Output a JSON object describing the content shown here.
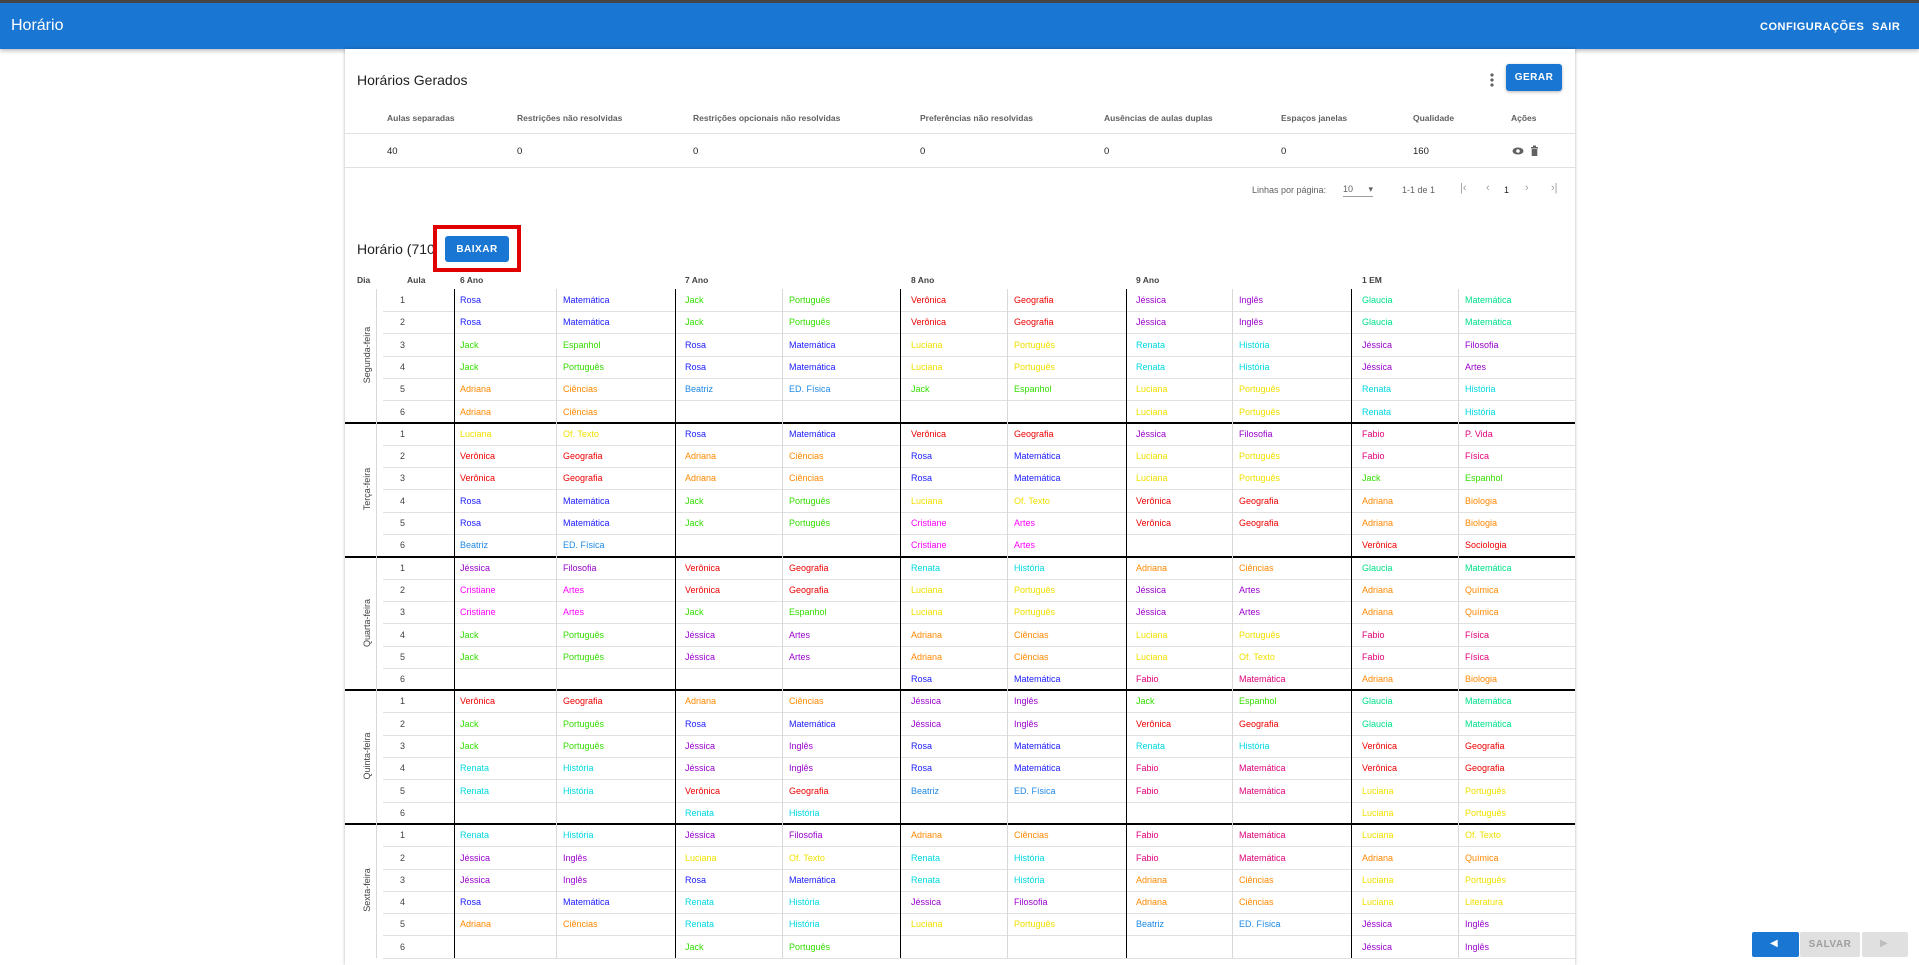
{
  "app": {
    "title": "Horário",
    "settings_label": "CONFIGURAÇÕES",
    "logout_label": "SAIR"
  },
  "generated": {
    "title": "Horários Gerados",
    "generate_label": "GERAR",
    "columns": [
      "Aulas separadas",
      "Restrições não resolvidas",
      "Restrições opcionais não resolvidas",
      "Preferências não resolvidas",
      "Ausências de aulas duplas",
      "Espaços janelas",
      "Qualidade",
      "Ações"
    ],
    "row": [
      "40",
      "0",
      "0",
      "0",
      "0",
      "0",
      "160"
    ],
    "pagination": {
      "rows_per_page_label": "Linhas por página:",
      "rows_per_page": "10",
      "range": "1-1 de 1",
      "page": "1"
    }
  },
  "schedule": {
    "title": "Horário (710",
    "download_label": "BAIXAR",
    "day_header": "Dia",
    "lesson_header": "Aula",
    "classes": [
      "6 Ano",
      "7 Ano",
      "8 Ano",
      "9 Ano",
      "1 EM"
    ],
    "days": [
      {
        "name": "Segunda-feira",
        "rows": [
          [
            "1",
            "Rosa",
            "Matemática",
            "Jack",
            "Português",
            "Verônica",
            "Geografia",
            "Jéssica",
            "Inglês",
            "Glaucia",
            "Matemática"
          ],
          [
            "2",
            "Rosa",
            "Matemática",
            "Jack",
            "Português",
            "Verônica",
            "Geografia",
            "Jéssica",
            "Inglês",
            "Glaucia",
            "Matemática"
          ],
          [
            "3",
            "Jack",
            "Espanhol",
            "Rosa",
            "Matemática",
            "Luciana",
            "Português",
            "Renata",
            "História",
            "Jéssica",
            "Filosofia"
          ],
          [
            "4",
            "Jack",
            "Português",
            "Rosa",
            "Matemática",
            "Luciana",
            "Português",
            "Renata",
            "História",
            "Jéssica",
            "Artes"
          ],
          [
            "5",
            "Adriana",
            "Ciências",
            "Beatriz",
            "ED. Física",
            "Jack",
            "Espanhol",
            "Luciana",
            "Português",
            "Renata",
            "História"
          ],
          [
            "6",
            "Adriana",
            "Ciências",
            "",
            "",
            "",
            "",
            "Luciana",
            "Português",
            "Renata",
            "História"
          ]
        ]
      },
      {
        "name": "Terça-feira",
        "rows": [
          [
            "1",
            "Luciana",
            "Of. Texto",
            "Rosa",
            "Matemática",
            "Verônica",
            "Geografia",
            "Jéssica",
            "Filosofia",
            "Fabio",
            "P. Vida"
          ],
          [
            "2",
            "Verônica",
            "Geografia",
            "Adriana",
            "Ciências",
            "Rosa",
            "Matemática",
            "Luciana",
            "Português",
            "Fabio",
            "Física"
          ],
          [
            "3",
            "Verônica",
            "Geografia",
            "Adriana",
            "Ciências",
            "Rosa",
            "Matemática",
            "Luciana",
            "Português",
            "Jack",
            "Espanhol"
          ],
          [
            "4",
            "Rosa",
            "Matemática",
            "Jack",
            "Português",
            "Luciana",
            "Of. Texto",
            "Verônica",
            "Geografia",
            "Adriana",
            "Biologia"
          ],
          [
            "5",
            "Rosa",
            "Matemática",
            "Jack",
            "Português",
            "Cristiane",
            "Artes",
            "Verônica",
            "Geografia",
            "Adriana",
            "Biologia"
          ],
          [
            "6",
            "Beatriz",
            "ED. Física",
            "",
            "",
            "Cristiane",
            "Artes",
            "",
            "",
            "Verônica",
            "Sociologia"
          ]
        ]
      },
      {
        "name": "Quarta-feira",
        "rows": [
          [
            "1",
            "Jéssica",
            "Filosofia",
            "Verônica",
            "Geografia",
            "Renata",
            "História",
            "Adriana",
            "Ciências",
            "Glaucia",
            "Matemática"
          ],
          [
            "2",
            "Cristiane",
            "Artes",
            "Verônica",
            "Geografia",
            "Luciana",
            "Português",
            "Jéssica",
            "Artes",
            "Adriana",
            "Química"
          ],
          [
            "3",
            "Cristiane",
            "Artes",
            "Jack",
            "Espanhol",
            "Luciana",
            "Português",
            "Jéssica",
            "Artes",
            "Adriana",
            "Química"
          ],
          [
            "4",
            "Jack",
            "Português",
            "Jéssica",
            "Artes",
            "Adriana",
            "Ciências",
            "Luciana",
            "Português",
            "Fabio",
            "Física"
          ],
          [
            "5",
            "Jack",
            "Português",
            "Jéssica",
            "Artes",
            "Adriana",
            "Ciências",
            "Luciana",
            "Of. Texto",
            "Fabio",
            "Física"
          ],
          [
            "6",
            "",
            "",
            "",
            "",
            "Rosa",
            "Matemática",
            "Fabio",
            "Matemática",
            "Adriana",
            "Biologia"
          ]
        ]
      },
      {
        "name": "Quinta-feira",
        "rows": [
          [
            "1",
            "Verônica",
            "Geografia",
            "Adriana",
            "Ciências",
            "Jéssica",
            "Inglês",
            "Jack",
            "Espanhol",
            "Glaucia",
            "Matemática"
          ],
          [
            "2",
            "Jack",
            "Português",
            "Rosa",
            "Matemática",
            "Jéssica",
            "Inglês",
            "Verônica",
            "Geografia",
            "Glaucia",
            "Matemática"
          ],
          [
            "3",
            "Jack",
            "Português",
            "Jéssica",
            "Inglês",
            "Rosa",
            "Matemática",
            "Renata",
            "História",
            "Verônica",
            "Geografia"
          ],
          [
            "4",
            "Renata",
            "História",
            "Jéssica",
            "Inglês",
            "Rosa",
            "Matemática",
            "Fabio",
            "Matemática",
            "Verônica",
            "Geografia"
          ],
          [
            "5",
            "Renata",
            "História",
            "Verônica",
            "Geografia",
            "Beatriz",
            "ED. Física",
            "Fabio",
            "Matemática",
            "Luciana",
            "Português"
          ],
          [
            "6",
            "",
            "",
            "Renata",
            "História",
            "",
            "",
            "",
            "",
            "Luciana",
            "Português"
          ]
        ]
      },
      {
        "name": "Sexta-feira",
        "rows": [
          [
            "1",
            "Renata",
            "História",
            "Jéssica",
            "Filosofia",
            "Adriana",
            "Ciências",
            "Fabio",
            "Matemática",
            "Luciana",
            "Of. Texto"
          ],
          [
            "2",
            "Jéssica",
            "Inglês",
            "Luciana",
            "Of. Texto",
            "Renata",
            "História",
            "Fabio",
            "Matemática",
            "Adriana",
            "Química"
          ],
          [
            "3",
            "Jéssica",
            "Inglês",
            "Rosa",
            "Matemática",
            "Renata",
            "História",
            "Adriana",
            "Ciências",
            "Luciana",
            "Português"
          ],
          [
            "4",
            "Rosa",
            "Matemática",
            "Renata",
            "História",
            "Jéssica",
            "Filosofia",
            "Adriana",
            "Ciências",
            "Luciana",
            "Literatura"
          ],
          [
            "5",
            "Adriana",
            "Ciências",
            "Renata",
            "História",
            "Luciana",
            "Português",
            "Beatriz",
            "ED. Física",
            "Jéssica",
            "Inglês"
          ],
          [
            "6",
            "",
            "",
            "Jack",
            "Português",
            "",
            "",
            "",
            "",
            "Jéssica",
            "Inglês"
          ]
        ]
      }
    ]
  },
  "teacher_colors": {
    "Rosa": "#1a1aff",
    "Jack": "#33dd00",
    "Verônica": "#ee0000",
    "Jéssica": "#9900cc",
    "Glaucia": "#00e08a",
    "Luciana": "#f0e000",
    "Renata": "#00d8e0",
    "Adriana": "#ff8800",
    "Beatriz": "#1e88e5",
    "Fabio": "#e0007a",
    "Cristiane": "#ff00ff"
  },
  "bottom_nav": {
    "save_label": "SALVAR"
  }
}
